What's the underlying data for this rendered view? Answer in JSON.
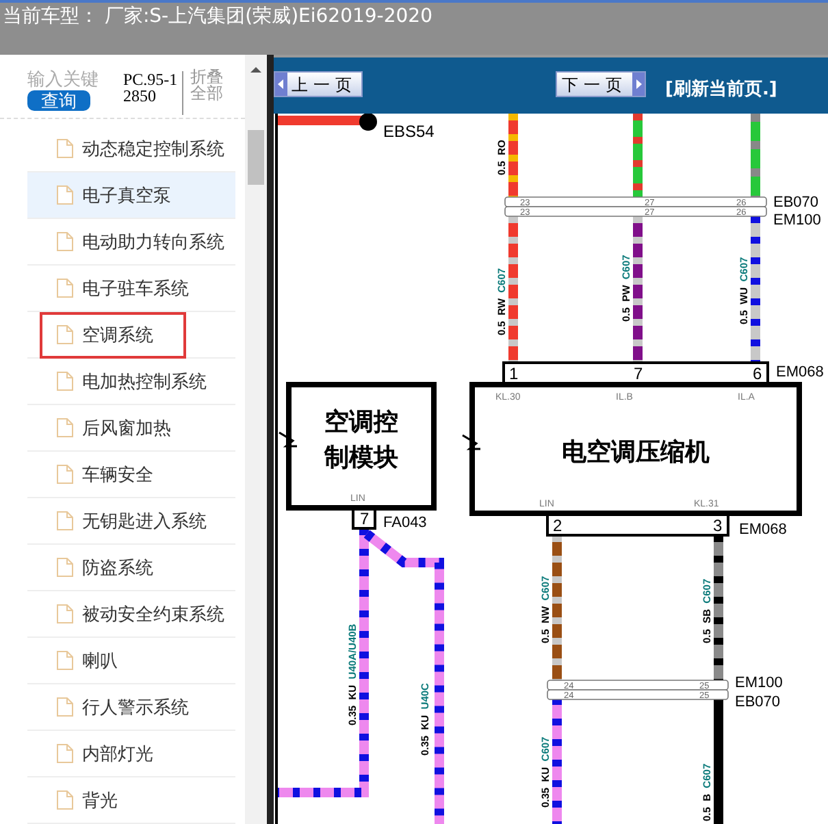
{
  "header": {
    "title": "当前车型： 厂家:S-上汽集团(荣威)Ei62019-2020"
  },
  "search": {
    "placeholder": "输入关键",
    "button": "查询",
    "code": "PC.95-12850",
    "collapse": "折叠全部"
  },
  "tree": {
    "items": [
      {
        "label": "动态稳定控制系统",
        "selected": false,
        "marked": false
      },
      {
        "label": "电子真空泵",
        "selected": true,
        "marked": false
      },
      {
        "label": "电动助力转向系统",
        "selected": false,
        "marked": false
      },
      {
        "label": "电子驻车系统",
        "selected": false,
        "marked": false
      },
      {
        "label": "空调系统",
        "selected": false,
        "marked": true
      },
      {
        "label": "电加热控制系统",
        "selected": false,
        "marked": false
      },
      {
        "label": "后风窗加热",
        "selected": false,
        "marked": false
      },
      {
        "label": "车辆安全",
        "selected": false,
        "marked": false
      },
      {
        "label": "无钥匙进入系统",
        "selected": false,
        "marked": false
      },
      {
        "label": "防盗系统",
        "selected": false,
        "marked": false
      },
      {
        "label": "被动安全约束系统",
        "selected": false,
        "marked": false
      },
      {
        "label": "喇叭",
        "selected": false,
        "marked": false
      },
      {
        "label": "行人警示系统",
        "selected": false,
        "marked": false
      },
      {
        "label": "内部灯光",
        "selected": false,
        "marked": false
      },
      {
        "label": "背光",
        "selected": false,
        "marked": false
      }
    ]
  },
  "toolbar": {
    "prev": "上一页",
    "next": "下一页",
    "refresh": "[刷新当前页.]"
  },
  "diagram": {
    "splice": {
      "label": "EBS54"
    },
    "wires": [
      {
        "gauge": "0.5",
        "code": "RO"
      },
      {
        "gauge": "0.5",
        "code": "RW",
        "circuit": "C607"
      },
      {
        "gauge": "0.5",
        "code": "PW",
        "circuit": "C607"
      },
      {
        "gauge": "0.5",
        "code": "WU",
        "circuit": "C607"
      },
      {
        "gauge": "0.35",
        "code": "KU",
        "circuit": "U40A/U40B"
      },
      {
        "gauge": "0.35",
        "code": "KU",
        "circuit": "U40C"
      },
      {
        "gauge": "0.5",
        "code": "NW",
        "circuit": "C607"
      },
      {
        "gauge": "0.5",
        "code": "SB",
        "circuit": "C607"
      },
      {
        "gauge": "0.35",
        "code": "KU",
        "circuit": "C607"
      },
      {
        "gauge": "0.5",
        "code": "B",
        "circuit": "C607"
      }
    ],
    "connectors": [
      {
        "label": "EB070",
        "pins": [
          "23",
          "27",
          "26"
        ]
      },
      {
        "label": "EM100",
        "pins": [
          "23",
          "27",
          "26"
        ]
      },
      {
        "label": "EM068",
        "pins": [
          "1",
          "7",
          "6"
        ]
      },
      {
        "label": "FA043",
        "pins": [
          "7"
        ]
      },
      {
        "label": "EM068",
        "pins": [
          "2",
          "3"
        ]
      },
      {
        "label": "EM100",
        "pins": [
          "24",
          "25"
        ]
      },
      {
        "label": "EB070",
        "pins": [
          "24",
          "25"
        ]
      }
    ],
    "modules": [
      {
        "label": "空调控制模块",
        "pins": [
          "LIN"
        ]
      },
      {
        "label": "电空调压缩机",
        "pins": [
          "KL.30",
          "IL.B",
          "IL.A",
          "LIN",
          "KL.31"
        ]
      }
    ]
  }
}
